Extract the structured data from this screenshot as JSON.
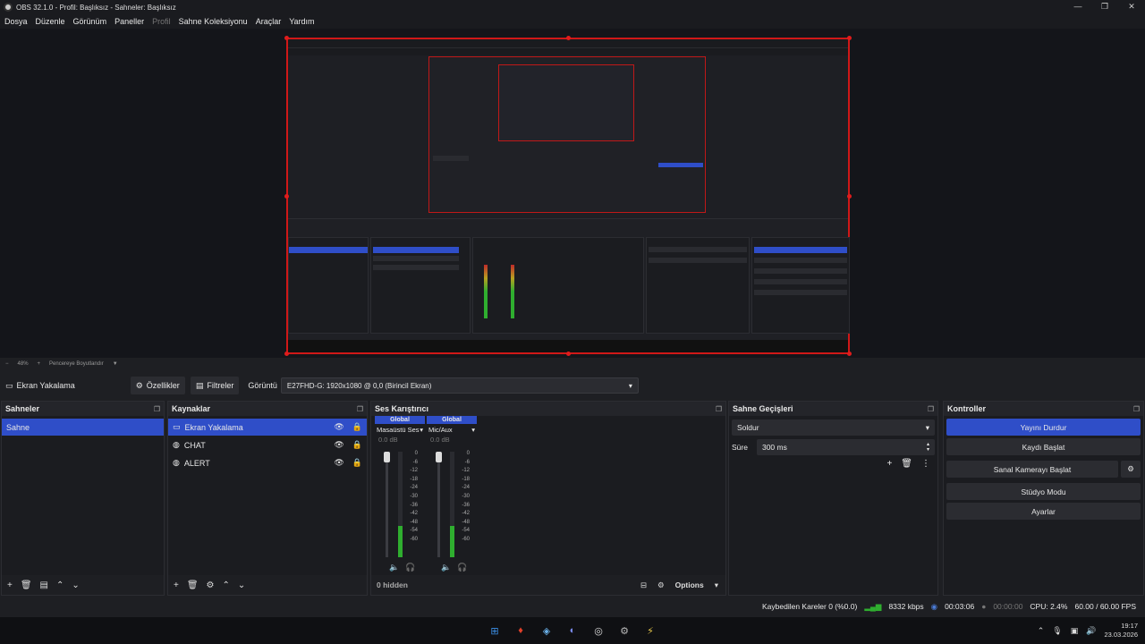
{
  "window": {
    "title": "OBS 32.1.0 - Profil: Başlıksız - Sahneler: Başlıksız",
    "controls": [
      "—",
      "❐",
      "✕"
    ]
  },
  "menu": [
    "Dosya",
    "Düzenle",
    "Görünüm",
    "Paneller",
    "Profil",
    "Sahne Koleksiyonu",
    "Araçlar",
    "Yardım"
  ],
  "zoom": {
    "level": "48%",
    "fit_label": "Pencereye Boyutlandır"
  },
  "source_toolbar": {
    "source_name": "Ekran Yakalama",
    "properties_label": "Özellikler",
    "filters_label": "Filtreler",
    "display_label": "Görüntü",
    "display_value": "E27FHD-G: 1920x1080 @ 0,0 (Birincil Ekran)"
  },
  "scenes": {
    "title": "Sahneler",
    "items": [
      "Sahne"
    ]
  },
  "sources": {
    "title": "Kaynaklar",
    "items": [
      {
        "name": "Ekran Yakalama",
        "icon": "monitor-icon"
      },
      {
        "name": "CHAT",
        "icon": "globe-icon"
      },
      {
        "name": "ALERT",
        "icon": "globe-icon"
      }
    ]
  },
  "mixer": {
    "title": "Ses Karıştırıcı",
    "channels": [
      {
        "badge": "Global",
        "name": "Masaüstü Ses",
        "db": "0.0 dB",
        "level": 0.3
      },
      {
        "badge": "Global",
        "name": "Mic/Aux",
        "db": "0.0 dB",
        "level": 0.3
      }
    ],
    "ticks": [
      "0",
      "-6",
      "-12",
      "-18",
      "-24",
      "-30",
      "-36",
      "-42",
      "-48",
      "-54",
      "-60"
    ],
    "hidden_label": "0 hidden",
    "options_label": "Options"
  },
  "transitions": {
    "title": "Sahne Geçişleri",
    "selected": "Soldur",
    "duration_label": "Süre",
    "duration_value": "300 ms"
  },
  "controls": {
    "title": "Kontroller",
    "stop_stream": "Yayını Durdur",
    "start_record": "Kaydı Başlat",
    "virtual_cam": "Sanal Kamerayı Başlat",
    "studio_mode": "Stüdyo Modu",
    "settings": "Ayarlar"
  },
  "status": {
    "dropped_frames": "Kaybedilen Kareler 0 (%0.0)",
    "bitrate": "8332 kbps",
    "stream_time": "00:03:06",
    "record_time": "00:00:00",
    "cpu": "CPU: 2.4%",
    "fps": "60.00 / 60.00 FPS"
  },
  "taskbar": {
    "time": "19:17",
    "date": "23.03.2026"
  },
  "colors": {
    "accent": "#2f4ec8",
    "preview_border": "#d01818",
    "background": "#1e1f23"
  }
}
